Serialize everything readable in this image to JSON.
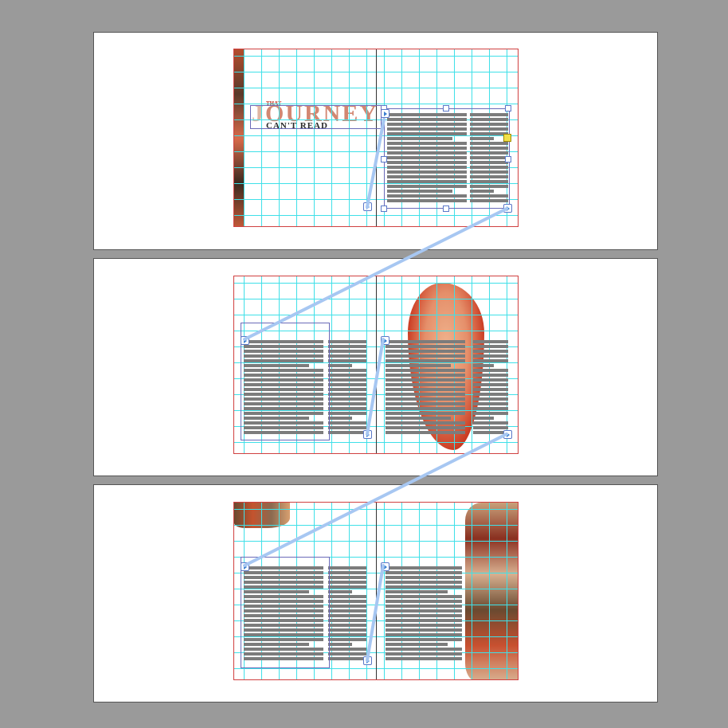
{
  "colors": {
    "background": "#9a9a9a",
    "pasteboard": "#ffffff",
    "guide": "#3fe0e8",
    "bleed": "#d04040",
    "thread": "#a7c7f2",
    "text_placeholder": "#7c7c7c",
    "frame_border": "#6a6ab8",
    "art_orange": "#e8a07a",
    "art_red": "#c8341c"
  },
  "spread1": {
    "headline_small": "THAT",
    "headline_subtitle": "CAN'T READ"
  },
  "icons": {
    "in_port": "in-port-icon",
    "out_port": "out-port-icon",
    "overset": "overset-icon"
  }
}
